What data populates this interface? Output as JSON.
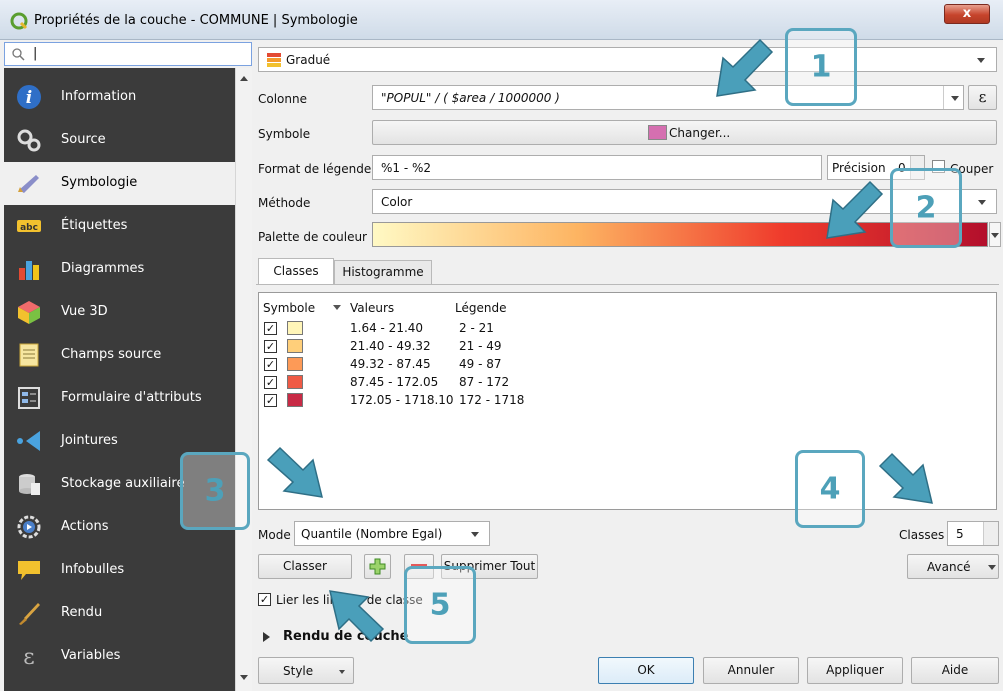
{
  "window": {
    "title": "Propriétés de la couche - COMMUNE | Symbologie",
    "close_label": "x"
  },
  "search": {
    "value": "|"
  },
  "sidebar": {
    "items": [
      {
        "label": "Information",
        "icon": "info-icon"
      },
      {
        "label": "Source",
        "icon": "source-icon"
      },
      {
        "label": "Symbologie",
        "icon": "paintbrush-icon"
      },
      {
        "label": "Étiquettes",
        "icon": "abc-label-icon"
      },
      {
        "label": "Diagrammes",
        "icon": "diagram-icon"
      },
      {
        "label": "Vue 3D",
        "icon": "cube-icon"
      },
      {
        "label": "Champs source",
        "icon": "fields-icon"
      },
      {
        "label": "Formulaire d'attributs",
        "icon": "form-icon"
      },
      {
        "label": "Jointures",
        "icon": "join-icon"
      },
      {
        "label": "Stockage auxiliaire",
        "icon": "database-icon"
      },
      {
        "label": "Actions",
        "icon": "gear-play-icon"
      },
      {
        "label": "Infobulles",
        "icon": "speech-bubble-icon"
      },
      {
        "label": "Rendu",
        "icon": "brush-icon"
      },
      {
        "label": "Variables",
        "icon": "epsilon-icon"
      }
    ],
    "active_index": 2
  },
  "renderer": {
    "value": "Gradué"
  },
  "form": {
    "colonne_label": "Colonne",
    "colonne_value": "\"POPUL\" / ( $area / 1000000 )",
    "symbole_label": "Symbole",
    "symbole_button": "Changer...",
    "symbole_color": "#d56fb0",
    "legend_format_label": "Format de légende",
    "legend_format_value": "%1 - %2",
    "precision_label": "Précision",
    "precision_value": "0",
    "couper_label": "Couper",
    "methode_label": "Méthode",
    "methode_value": "Color",
    "palette_label": "Palette de couleur",
    "palette_colors": [
      "#fff9c4",
      "#fdb462",
      "#ef3b2c",
      "#b30f2c"
    ]
  },
  "tabs": {
    "classes": "Classes",
    "histogramme": "Histogramme"
  },
  "table": {
    "headers": {
      "symbole": "Symbole",
      "valeurs": "Valeurs",
      "legende": "Légende"
    },
    "rows": [
      {
        "checked": true,
        "color": "#fff5b8",
        "valeurs": "1.64 - 21.40",
        "legende": "2 - 21"
      },
      {
        "checked": true,
        "color": "#ffcf7a",
        "valeurs": "21.40 - 49.32",
        "legende": "21 - 49"
      },
      {
        "checked": true,
        "color": "#fd9a57",
        "valeurs": "49.32 - 87.45",
        "legende": "49 - 87"
      },
      {
        "checked": true,
        "color": "#ef5a45",
        "valeurs": "87.45 - 172.05",
        "legende": "87 - 172"
      },
      {
        "checked": true,
        "color": "#c82a45",
        "valeurs": "172.05 - 1718.10",
        "legende": "172 - 1718"
      }
    ]
  },
  "mode": {
    "label": "Mode",
    "value": "Quantile (Nombre Egal)"
  },
  "classes": {
    "label": "Classes",
    "value": "5"
  },
  "buttons": {
    "classer": "Classer",
    "supprimer_tout": "Supprimer Tout",
    "avance": "Avancé",
    "style": "Style",
    "ok": "OK",
    "annuler": "Annuler",
    "appliquer": "Appliquer",
    "aide": "Aide"
  },
  "lier_limites": {
    "label": "Lier les limites de classe",
    "checked": true
  },
  "rendu_couche": "Rendu de couche",
  "annotations": [
    "1",
    "2",
    "3",
    "4",
    "5"
  ],
  "colors": {
    "sidebar_bg": "#3b3b3b",
    "annotation": "#5aa7bf",
    "arrow": "#4a9fba"
  }
}
